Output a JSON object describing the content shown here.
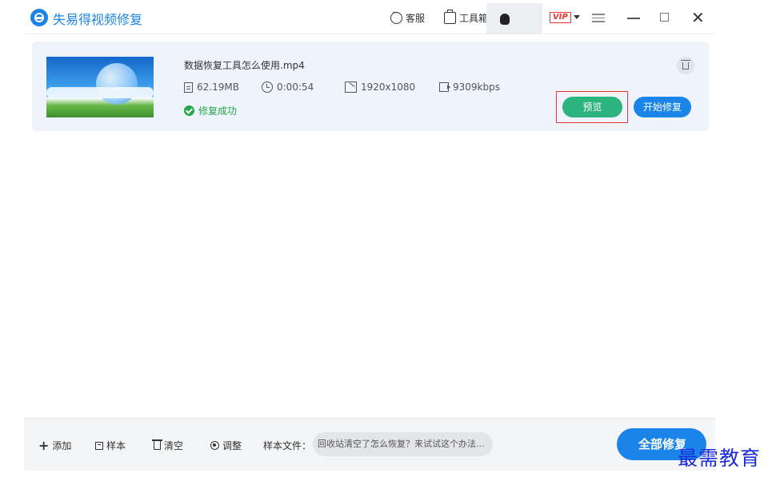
{
  "app": {
    "title": "失易得视频修复"
  },
  "toolbar": {
    "service_label": "客服",
    "toolbox_label": "工具箱",
    "vip_label": "VIP"
  },
  "file": {
    "name": "数据恢复工具怎么使用.mp4",
    "size": "62.19MB",
    "duration": "0:00:54",
    "resolution": "1920x1080",
    "bitrate": "9309kbps",
    "status": "修复成功",
    "preview_label": "预览",
    "start_label": "开始修复"
  },
  "bottom": {
    "add_label": "添加",
    "sample_label": "样本",
    "clear_label": "清空",
    "adjust_label": "调整",
    "sample_file_label": "样本文件：",
    "sample_file_value": "回收站清空了怎么恢复？来试试这个办法...",
    "repair_all_label": "全部修复"
  },
  "watermark": "最需教育",
  "colors": {
    "accent": "#1a84e8",
    "success": "#2db37d",
    "highlight": "#e53935"
  }
}
